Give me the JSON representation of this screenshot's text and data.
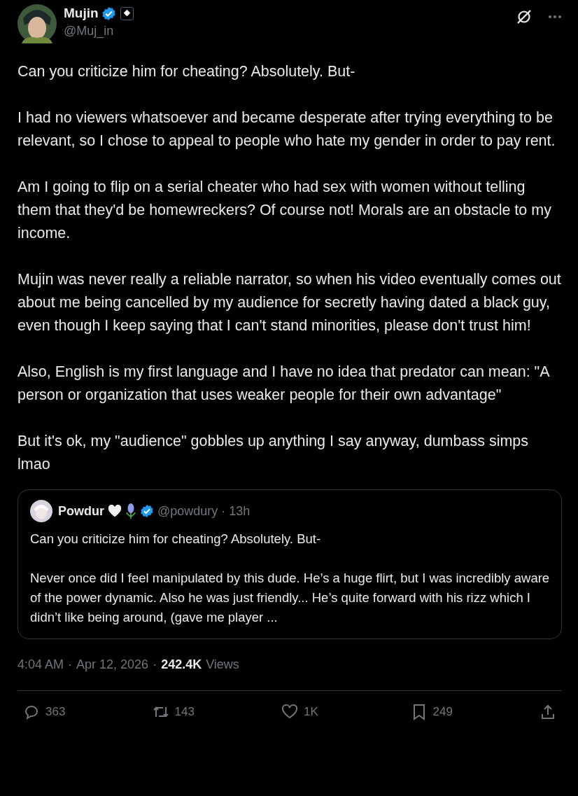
{
  "author": {
    "name": "Mujin",
    "handle": "@Muj_in",
    "verified": true
  },
  "paragraphs": [
    "Can you criticize him for cheating? Absolutely. But-",
    "I had no viewers whatsoever and became desperate after trying everything to be relevant, so I chose to appeal to people who hate my gender in order to pay rent.",
    "Am I going to flip on a serial cheater who had sex with women without telling them that they'd be homewreckers? Of course not! Morals are an obstacle to my income.",
    "Mujin was never really a reliable narrator, so when his video eventually comes out about me being cancelled by my audience for secretly having dated a black guy, even though I keep saying that I can't stand minorities, please don't trust him!",
    "Also, English is my first language and I have no idea that predator can mean: \"A person or organization that uses weaker people for their own advantage\"",
    "But it's ok, my \"audience\" gobbles up anything I say anyway, dumbass simps lmao"
  ],
  "quoted": {
    "name": "Powdur",
    "verified": true,
    "handle": "@powdury",
    "separator": "·",
    "time": "13h",
    "paragraphs": [
      "Can you criticize him for cheating? Absolutely. But-",
      "Never once did I feel manipulated by this dude. He’s a huge flirt, but I was incredibly aware of the power dynamic. Also he was just friendly... He’s quite forward with his rizz which I didn’t like being around, (gave me player ..."
    ]
  },
  "timestamp": {
    "time": "4:04 AM",
    "separator_1": "·",
    "date": "Apr 12, 2026",
    "separator_2": "·",
    "views": "242.4K",
    "views_label": "Views"
  },
  "actions": [
    {
      "kind": "reply",
      "count": "363"
    },
    {
      "kind": "repost",
      "count": "143"
    },
    {
      "kind": "like",
      "count": "1K"
    },
    {
      "kind": "bookmark",
      "count": "249"
    },
    {
      "kind": "share"
    }
  ]
}
